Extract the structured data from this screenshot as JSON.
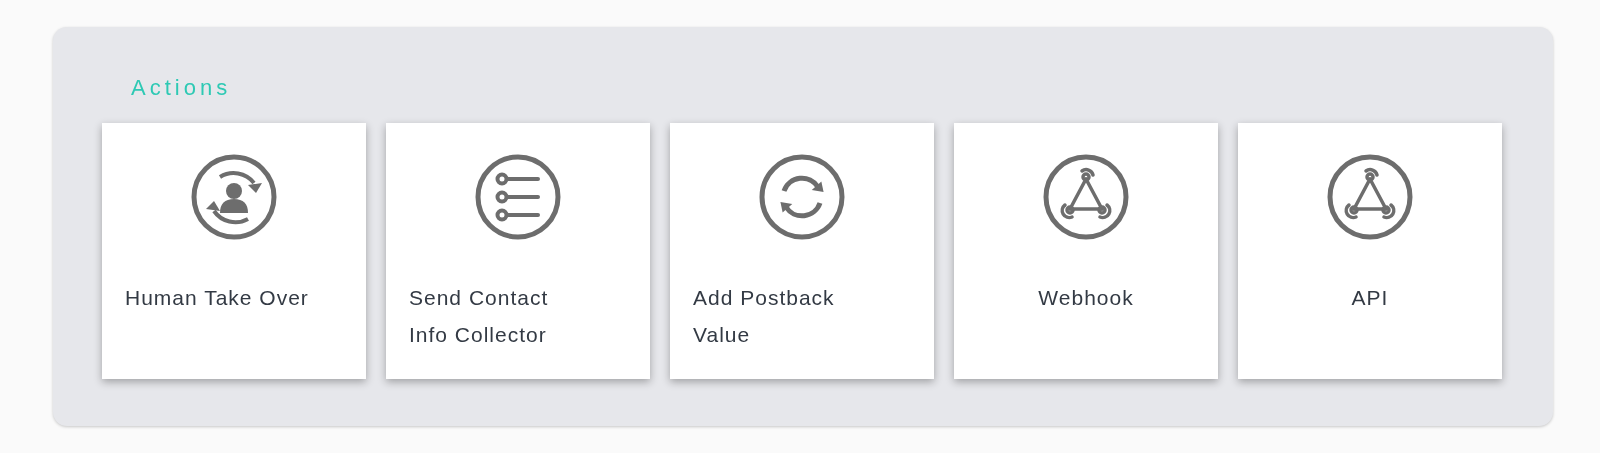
{
  "section": {
    "title": "Actions"
  },
  "actions": [
    {
      "label": "Human Take Over",
      "kind": "handover"
    },
    {
      "label": "Send Contact Info Collector",
      "kind": "collector"
    },
    {
      "label": "Add Postback Value",
      "kind": "postback"
    },
    {
      "label": "Webhook",
      "kind": "webhook"
    },
    {
      "label": "API",
      "kind": "api"
    }
  ]
}
